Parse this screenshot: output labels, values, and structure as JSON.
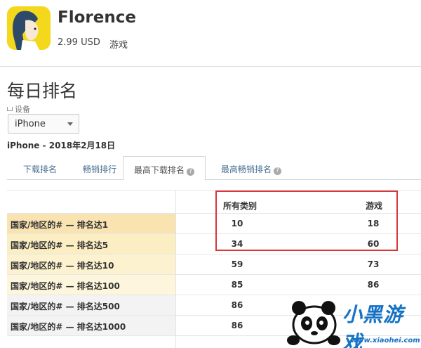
{
  "app": {
    "title": "Florence",
    "price": "2.99 USD",
    "genre": "游戏",
    "icon": "florence-app-icon"
  },
  "ranking": {
    "section_title": "每日排名",
    "device_label": "设备",
    "device_value": "iPhone",
    "date_line": "iPhone - 2018年2月18日"
  },
  "tabs": [
    {
      "label": "下载排名",
      "active": false,
      "help": false
    },
    {
      "label": "畅销排行",
      "active": false,
      "help": false
    },
    {
      "label": "最高下载排名",
      "active": true,
      "help": true
    },
    {
      "label": "最高畅销排名",
      "active": false,
      "help": true
    }
  ],
  "table": {
    "columns": [
      "所有类别",
      "游戏"
    ],
    "rows": [
      {
        "label": "国家/地区的# — 排名达1",
        "all": "10",
        "games": "18",
        "bg": "#f9e3b1"
      },
      {
        "label": "国家/地区的# — 排名达5",
        "all": "34",
        "games": "60",
        "bg": "#fbeec3"
      },
      {
        "label": "国家/地区的# — 排名达10",
        "all": "59",
        "games": "73",
        "bg": "#fdf2cf"
      },
      {
        "label": "国家/地区的# — 排名达100",
        "all": "85",
        "games": "86",
        "bg": "#fdf6dc"
      },
      {
        "label": "国家/地区的# — 排名达500",
        "all": "86",
        "games": "",
        "bg": "#f3f3f3"
      },
      {
        "label": "国家/地区的# — 排名达1000",
        "all": "86",
        "games": "",
        "bg": "#f3f3f3"
      }
    ]
  },
  "colors": {
    "highlight": "#d9373a",
    "tab_link": "#4a6f93",
    "watermark": "#1572c5"
  },
  "watermark": {
    "text": "小黑游戏",
    "url": "www.xiaohei.com"
  }
}
